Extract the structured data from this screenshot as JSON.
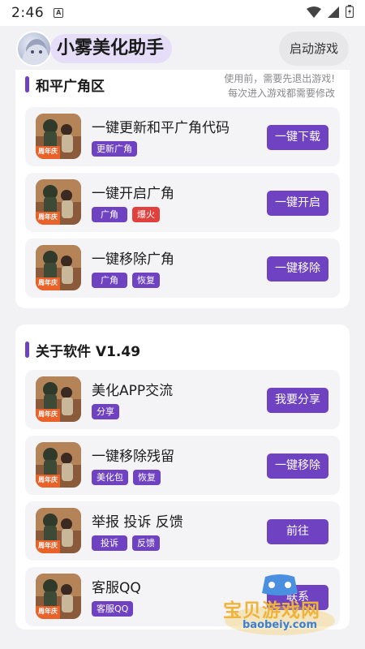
{
  "status_bar": {
    "time": "2:46",
    "notif_icon": "A"
  },
  "header": {
    "title": "小雾美化助手",
    "launch_label": "启动游戏"
  },
  "section1": {
    "title": "和平广角区",
    "notice_line1": "使用前，需要先退出游戏!",
    "notice_line2": "每次进入游戏都需要修改",
    "items": [
      {
        "title": "一键更新和平广角代码",
        "tags": [
          {
            "text": "更新广角",
            "color": "purple"
          }
        ],
        "action": "一键下载"
      },
      {
        "title": "一键开启广角",
        "tags": [
          {
            "text": "广角",
            "color": "purple"
          },
          {
            "text": "爆火",
            "color": "red"
          }
        ],
        "action": "一键开启"
      },
      {
        "title": "一键移除广角",
        "tags": [
          {
            "text": "广角",
            "color": "purple"
          },
          {
            "text": "恢复",
            "color": "purple"
          }
        ],
        "action": "一键移除"
      }
    ]
  },
  "section2": {
    "title": "关于软件 V1.49",
    "items": [
      {
        "title": "美化APP交流",
        "tags": [
          {
            "text": "分享",
            "color": "purple"
          }
        ],
        "action": "我要分享"
      },
      {
        "title": "一键移除残留",
        "tags": [
          {
            "text": "美化包",
            "color": "purple"
          },
          {
            "text": "恢复",
            "color": "purple"
          }
        ],
        "action": "一键移除"
      },
      {
        "title": "举报 投诉 反馈",
        "tags": [
          {
            "text": "投诉",
            "color": "purple"
          },
          {
            "text": "反馈",
            "color": "purple"
          }
        ],
        "action": "前往"
      },
      {
        "title": "客服QQ",
        "tags": [
          {
            "text": "客服QQ",
            "color": "purple"
          }
        ],
        "action": "联系"
      }
    ]
  },
  "thumb_badge": "周年庆",
  "watermark": {
    "text": "宝贝游戏网",
    "url": "baobeiy.com"
  },
  "colors": {
    "accent": "#6e42c1",
    "tag_red": "#e0413d",
    "title_pill": "#e6def8"
  }
}
